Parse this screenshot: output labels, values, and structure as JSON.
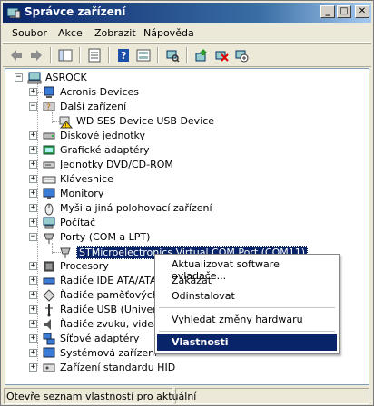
{
  "window": {
    "title": "Správce zařízení",
    "min_glyph": "_",
    "max_glyph": "□",
    "close_glyph": "✕"
  },
  "menu": [
    "Soubor",
    "Akce",
    "Zobrazit",
    "Nápověda"
  ],
  "tree": {
    "root": "ASROCK",
    "items": [
      {
        "label": "Acronis Devices",
        "expander": "+"
      },
      {
        "label": "Další zařízení",
        "expander": "−"
      },
      {
        "label": "WD SES Device USB Device",
        "child": true
      },
      {
        "label": "Diskové jednotky",
        "expander": "+"
      },
      {
        "label": "Grafické adaptéry",
        "expander": "+"
      },
      {
        "label": "Jednotky DVD/CD-ROM",
        "expander": "+"
      },
      {
        "label": "Klávesnice",
        "expander": "+"
      },
      {
        "label": "Monitory",
        "expander": "+"
      },
      {
        "label": "Myši a jiná polohovací zařízení",
        "expander": "+"
      },
      {
        "label": "Počítač",
        "expander": "+"
      },
      {
        "label": "Porty (COM a LPT)",
        "expander": "−"
      },
      {
        "label": "STMicroelectronics Virtual COM Port (COM11)",
        "child": true,
        "selected": true
      },
      {
        "label": "Procesory",
        "expander": "+"
      },
      {
        "label": "Řadiče IDE ATA/ATAPI",
        "expander": "+"
      },
      {
        "label": "Řadiče paměťových z",
        "expander": "+"
      },
      {
        "label": "Řadiče USB (Universa",
        "expander": "+"
      },
      {
        "label": "Řadiče zvuku, videa",
        "expander": "+"
      },
      {
        "label": "Síťové adaptéry",
        "expander": "+"
      },
      {
        "label": "Systémová zařízení",
        "expander": "+"
      },
      {
        "label": "Zařízení standardu HID",
        "expander": "+"
      }
    ]
  },
  "context_menu": {
    "items": [
      {
        "label": "Aktualizovat software ovladače..."
      },
      {
        "label": "Zakázat"
      },
      {
        "label": "Odinstalovat"
      },
      {
        "label": "Vyhledat změny hardwaru"
      },
      {
        "label": "Vlastnosti",
        "highlighted": true
      }
    ]
  },
  "status": {
    "text": "Otevře seznam vlastností pro aktuální"
  },
  "colors": {
    "selection": "#0a246a",
    "titlebar": "#0a246a"
  }
}
